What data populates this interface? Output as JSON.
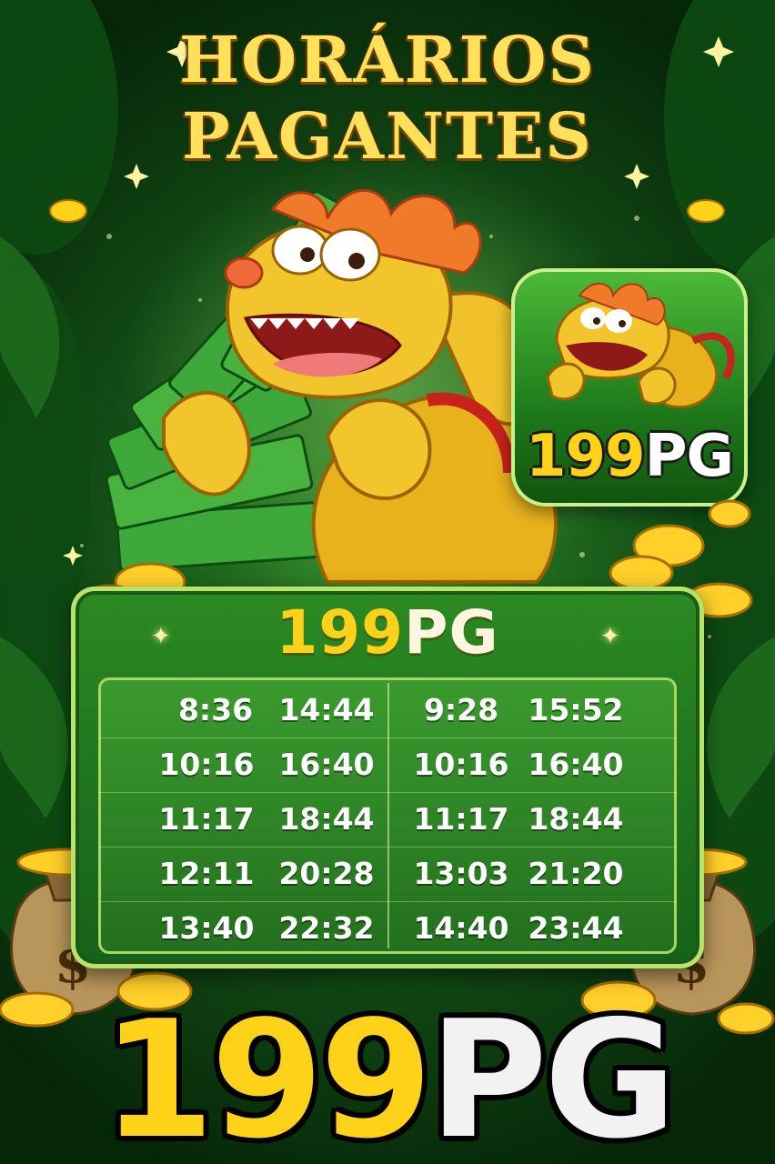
{
  "title": {
    "line1": "HORÁRIOS",
    "line2": "PAGANTES"
  },
  "app_icon": {
    "logo_digits": "199",
    "logo_letters": "PG"
  },
  "board": {
    "brand_digits": "199",
    "brand_letters": "PG",
    "times": [
      [
        "8:36",
        "14:44",
        "9:28",
        "15:52"
      ],
      [
        "10:16",
        "16:40",
        "10:16",
        "16:40"
      ],
      [
        "11:17",
        "18:44",
        "11:17",
        "18:44"
      ],
      [
        "12:11",
        "20:28",
        "13:03",
        "21:20"
      ],
      [
        "13:40",
        "22:32",
        "14:40",
        "23:44"
      ]
    ]
  },
  "footer_brand": {
    "digits": "199",
    "letters": "PG"
  },
  "colors": {
    "gold": "#ffd21a",
    "green_dark": "#134d16",
    "green_board": "#2c8a22",
    "cream": "#fff6e0"
  }
}
